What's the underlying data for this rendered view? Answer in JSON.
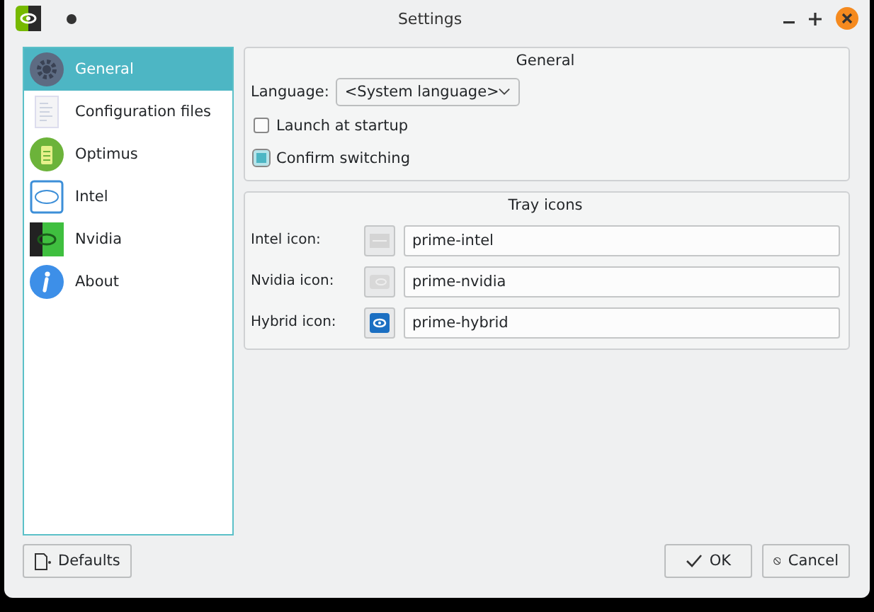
{
  "window": {
    "title": "Settings"
  },
  "sidebar": {
    "items": [
      {
        "label": "General",
        "kind": "gear",
        "selected": true
      },
      {
        "label": "Configuration files",
        "kind": "document",
        "selected": false
      },
      {
        "label": "Optimus",
        "kind": "battery",
        "selected": false
      },
      {
        "label": "Intel",
        "kind": "chip",
        "selected": false
      },
      {
        "label": "Nvidia",
        "kind": "eye",
        "selected": false
      },
      {
        "label": "About",
        "kind": "info",
        "selected": false
      }
    ]
  },
  "general": {
    "title": "General",
    "language_label": "Language:",
    "language_value": "<System language>",
    "checkboxes": [
      {
        "label": "Launch at startup",
        "checked": false
      },
      {
        "label": "Confirm switching",
        "checked": true
      }
    ]
  },
  "tray_icons": {
    "title": "Tray icons",
    "rows": [
      {
        "label": "Intel icon:",
        "kind": "intel",
        "value": "prime-intel"
      },
      {
        "label": "Nvidia icon:",
        "kind": "nvidia",
        "value": "prime-nvidia"
      },
      {
        "label": "Hybrid icon:",
        "kind": "hybrid",
        "value": "prime-hybrid"
      }
    ]
  },
  "buttons": {
    "defaults": "Defaults",
    "ok": "OK",
    "cancel": "Cancel"
  }
}
